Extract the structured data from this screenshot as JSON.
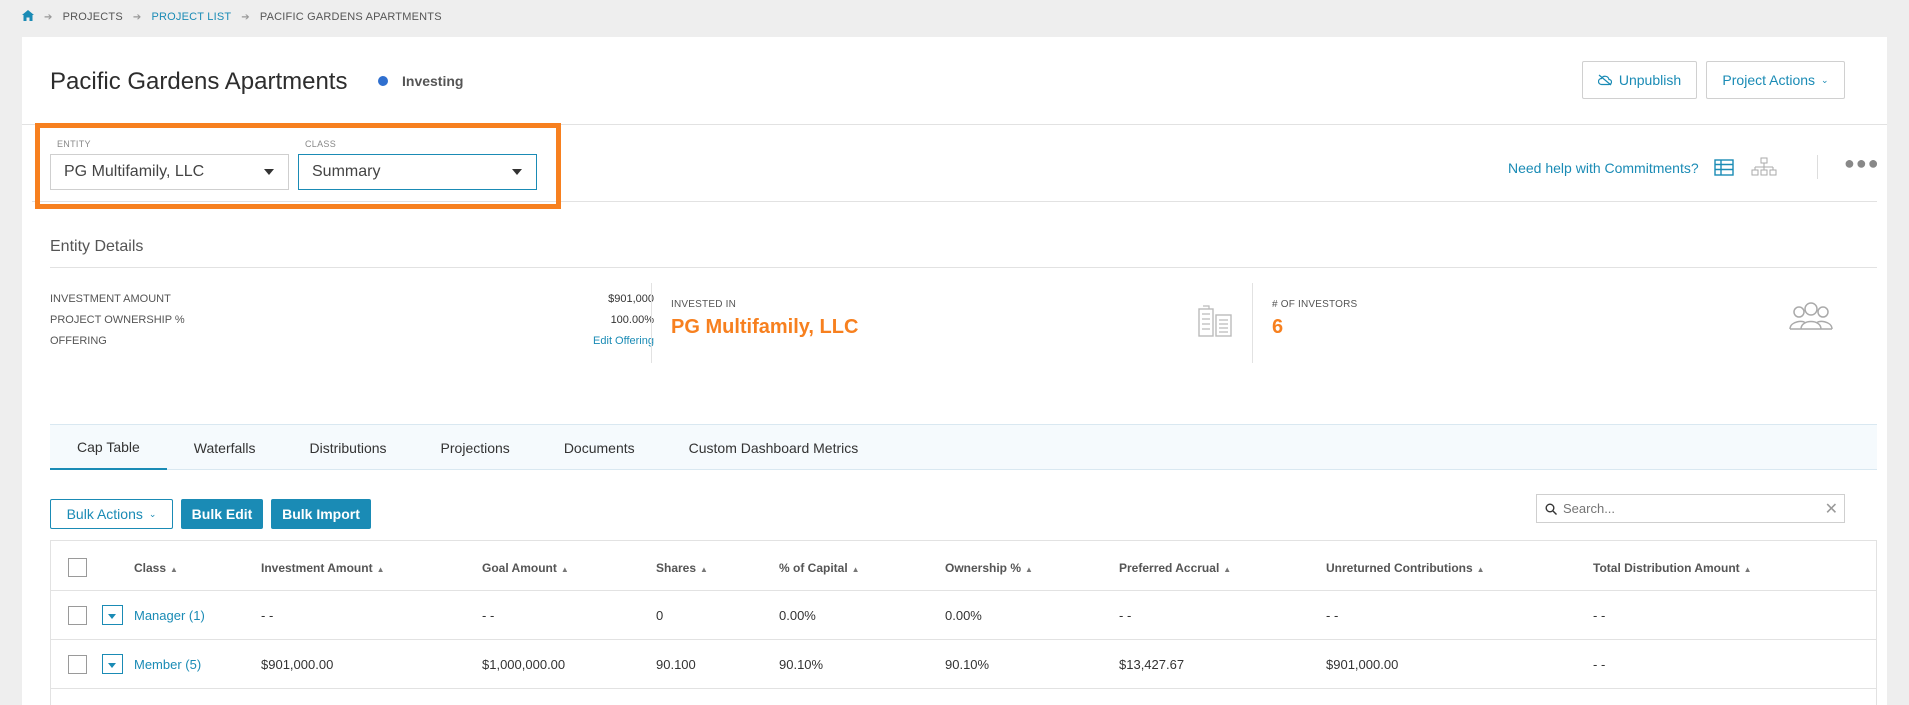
{
  "breadcrumb": {
    "home_icon": "home-icon",
    "items": [
      "PROJECTS",
      "PROJECT LIST",
      "PACIFIC GARDENS APARTMENTS"
    ]
  },
  "header": {
    "title": "Pacific Gardens Apartments",
    "status": "Investing",
    "status_color": "#2f6fcf",
    "unpublish_label": "Unpublish",
    "project_actions_label": "Project Actions"
  },
  "filters": {
    "entity_label": "ENTITY",
    "entity_value": "PG Multifamily, LLC",
    "class_label": "CLASS",
    "class_value": "Summary",
    "help_link": "Need help with Commitments?",
    "highlight_color": "#f7801f"
  },
  "entity_details": {
    "title": "Entity Details",
    "rows": [
      {
        "label": "INVESTMENT AMOUNT",
        "value": "$901,000"
      },
      {
        "label": "PROJECT OWNERSHIP %",
        "value": "100.00%"
      },
      {
        "label": "OFFERING",
        "value": "Edit Offering"
      }
    ],
    "invested_in_label": "INVESTED IN",
    "invested_in_value": "PG Multifamily, LLC",
    "investors_label": "# OF INVESTORS",
    "investors_value": "6"
  },
  "tabs": [
    "Cap Table",
    "Waterfalls",
    "Distributions",
    "Projections",
    "Documents",
    "Custom Dashboard Metrics"
  ],
  "toolbar": {
    "bulk_actions": "Bulk Actions",
    "bulk_edit": "Bulk Edit",
    "bulk_import": "Bulk Import",
    "search_placeholder": "Search..."
  },
  "table": {
    "headers": [
      "Class",
      "Investment Amount",
      "Goal Amount",
      "Shares",
      "% of Capital",
      "Ownership %",
      "Preferred Accrual",
      "Unreturned Contributions",
      "Total Distribution Amount"
    ],
    "rows": [
      [
        "Manager (1)",
        "- -",
        "- -",
        "0",
        "0.00%",
        "0.00%",
        "- -",
        "- -",
        "- -"
      ],
      [
        "Member (5)",
        "$901,000.00",
        "$1,000,000.00",
        "90.100",
        "90.10%",
        "90.10%",
        "$13,427.67",
        "$901,000.00",
        "- -"
      ]
    ]
  },
  "colors": {
    "accent": "#1a8bb5",
    "orange": "#f7801f"
  }
}
